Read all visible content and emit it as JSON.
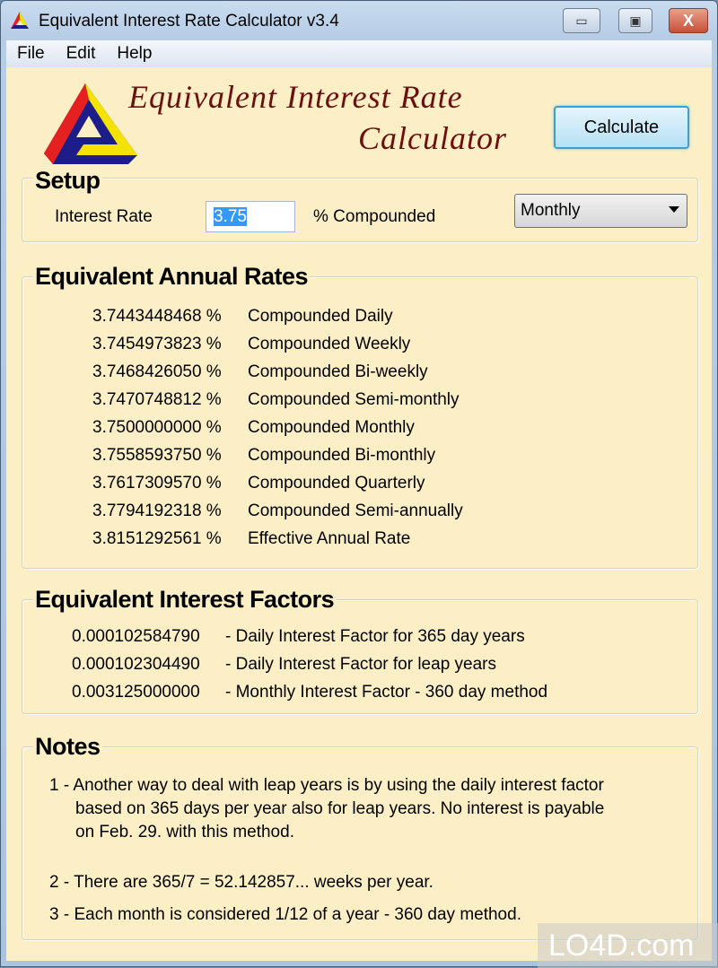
{
  "window": {
    "title": "Equivalent Interest Rate Calculator v3.4",
    "minimize": "▭",
    "maximize": "▣",
    "close": "X"
  },
  "menu": [
    {
      "label": "File"
    },
    {
      "label": "Edit"
    },
    {
      "label": "Help"
    }
  ],
  "header": {
    "logo_line1": "Equivalent Interest Rate",
    "logo_line2": "Calculator",
    "calculate_label": "Calculate"
  },
  "setup": {
    "title": "Setup",
    "rate_label": "Interest Rate",
    "rate_value": "3.75",
    "compounded_label": "% Compounded",
    "compounding": "Monthly"
  },
  "annual": {
    "title": "Equivalent Annual Rates",
    "rows": [
      {
        "value": "3.7443448468 %",
        "label": "Compounded Daily"
      },
      {
        "value": "3.7454973823 %",
        "label": "Compounded Weekly"
      },
      {
        "value": "3.7468426050 %",
        "label": "Compounded Bi-weekly"
      },
      {
        "value": "3.7470748812 %",
        "label": "Compounded Semi-monthly"
      },
      {
        "value": "3.7500000000 %",
        "label": "Compounded Monthly"
      },
      {
        "value": "3.7558593750 %",
        "label": "Compounded Bi-monthly"
      },
      {
        "value": "3.7617309570 %",
        "label": "Compounded Quarterly"
      },
      {
        "value": "3.7794192318 %",
        "label": "Compounded Semi-annually"
      },
      {
        "value": "3.8151292561 %",
        "label": "Effective Annual Rate"
      }
    ]
  },
  "factors": {
    "title": "Equivalent Interest Factors",
    "rows": [
      {
        "value": "0.000102584790",
        "label": "- Daily Interest Factor for 365 day years"
      },
      {
        "value": "0.000102304490",
        "label": "- Daily Interest Factor for leap years"
      },
      {
        "value": "0.003125000000",
        "label": "- Monthly Interest Factor - 360 day method"
      }
    ]
  },
  "notes": {
    "title": "Notes",
    "lines": [
      "1 - Another way to deal with leap years is by using the daily interest factor",
      "based on 365 days per year also for leap years. No interest is payable",
      "on Feb. 29. with this method.",
      "2 - There are 365/7 = 52.142857... weeks per year.",
      "3 - Each month is considered 1/12 of a year - 360 day method."
    ]
  },
  "watermark": "LO4D.com"
}
